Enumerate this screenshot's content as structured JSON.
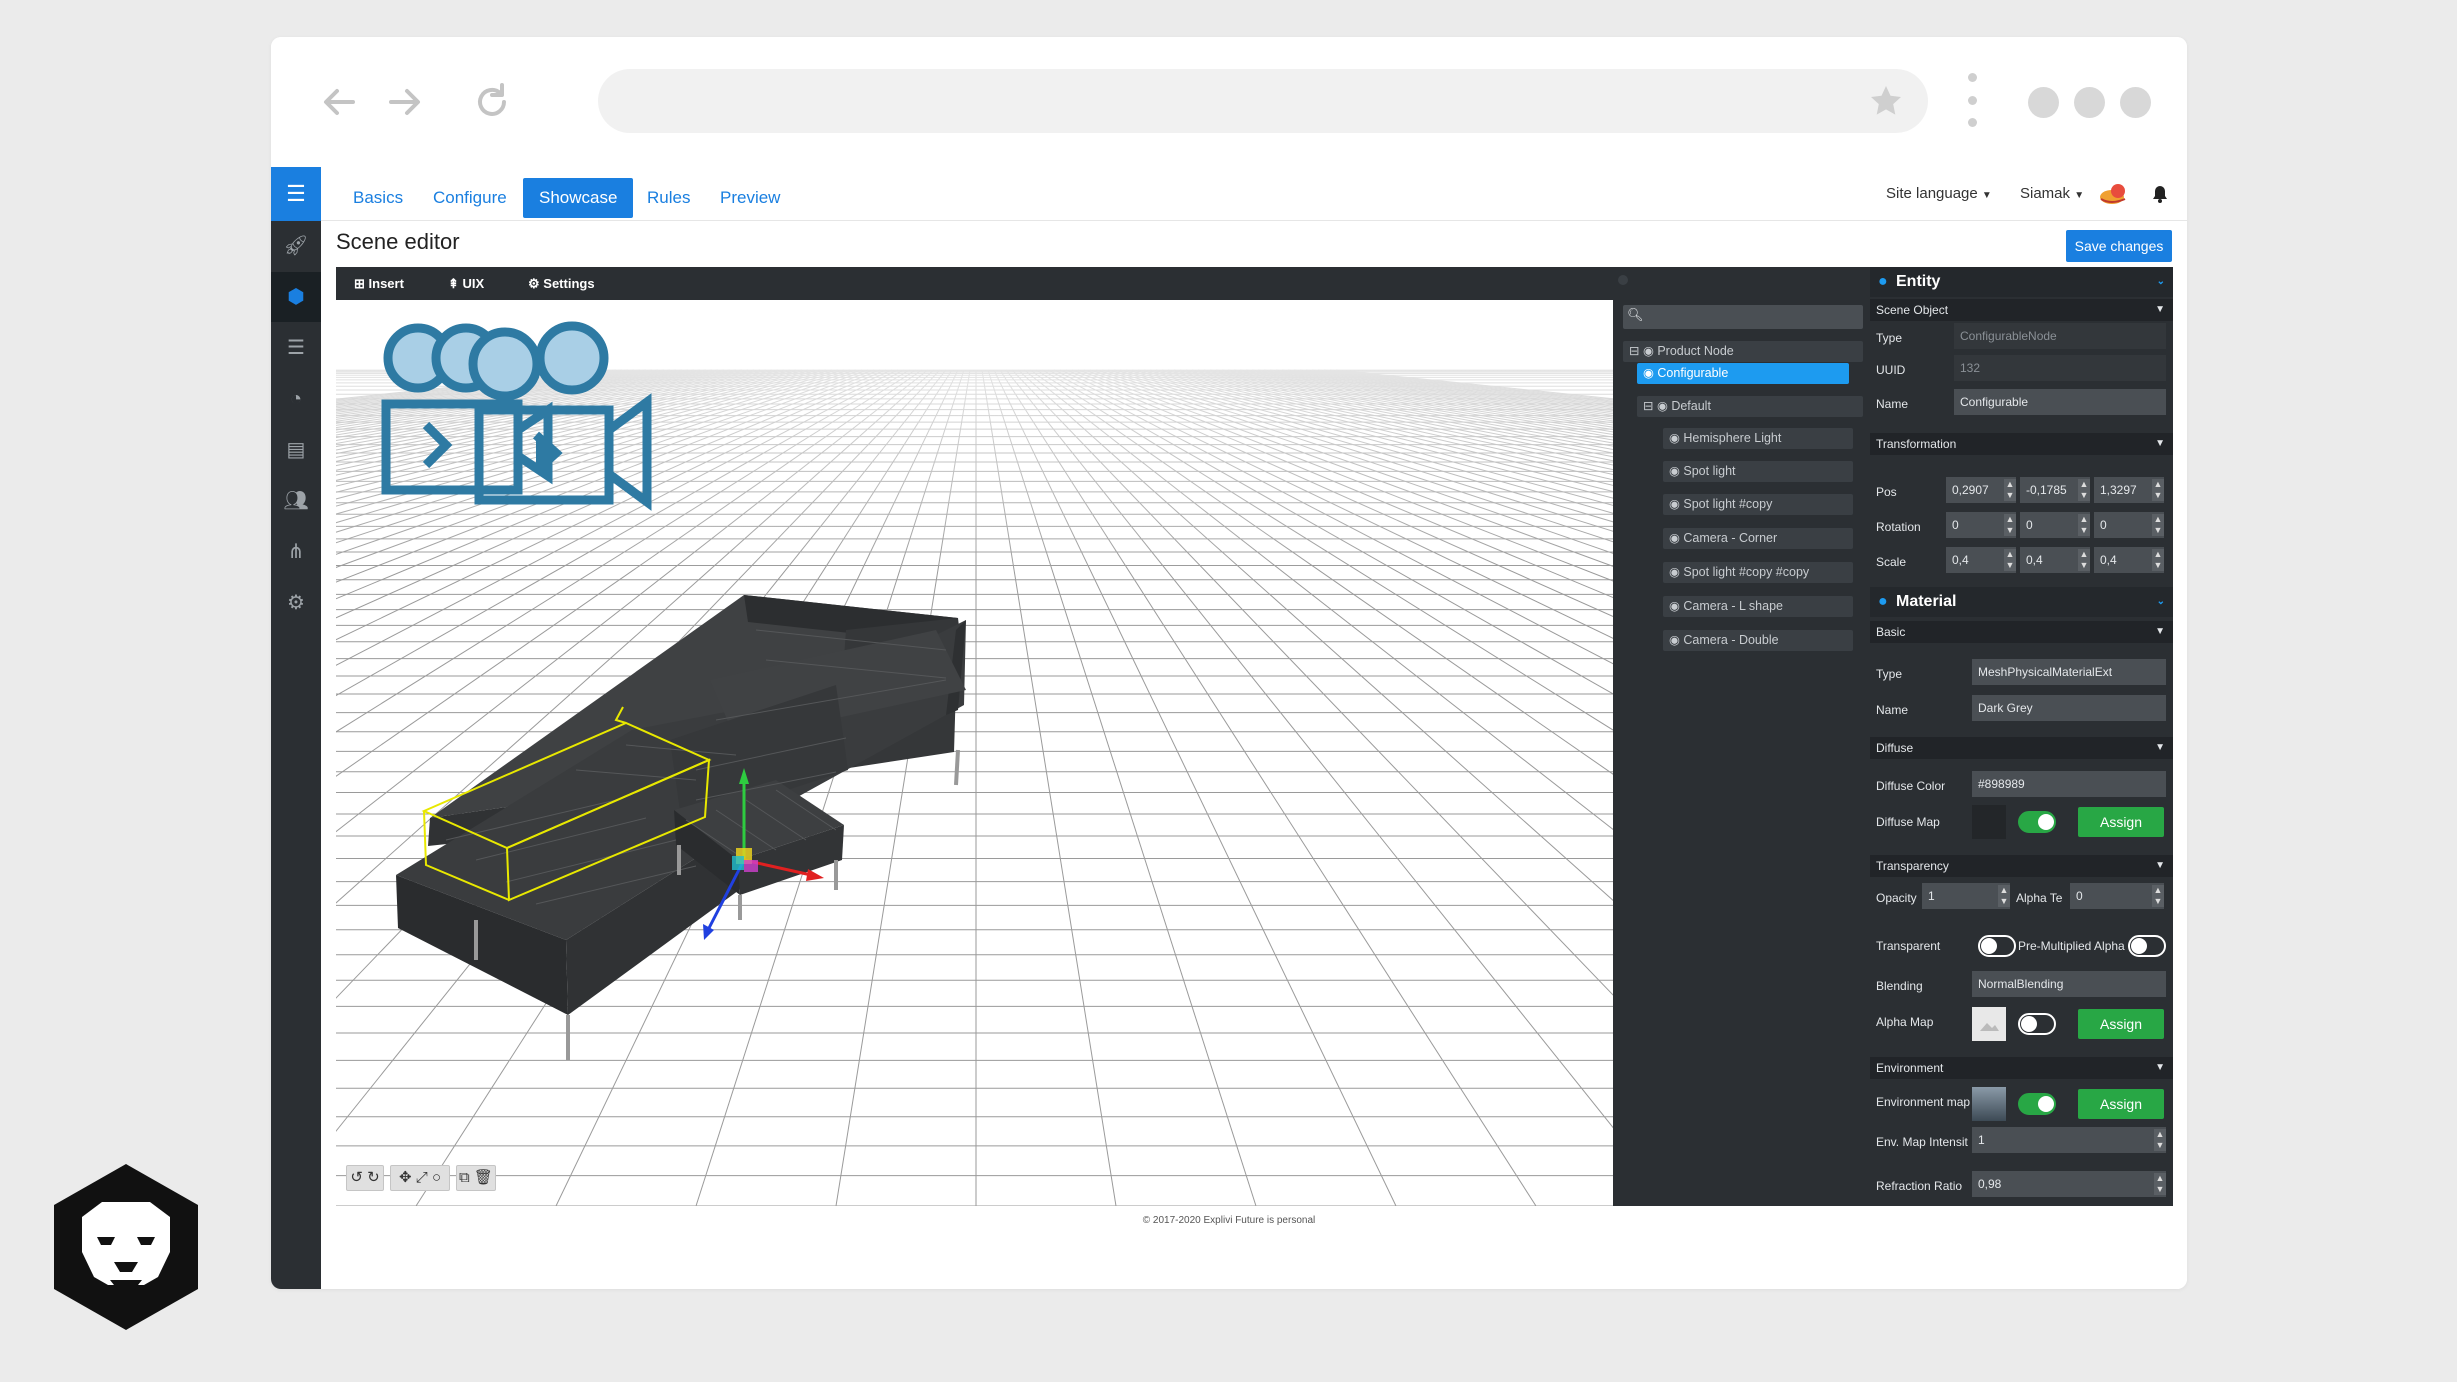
{
  "app": {
    "tabs": [
      "Basics",
      "Configure",
      "Showcase",
      "Rules",
      "Preview"
    ],
    "active_tab": "Showcase",
    "site_language": "Site language",
    "user": "Siamak",
    "page_title": "Scene editor",
    "save_label": "Save changes"
  },
  "viewport": {
    "toolbar": [
      "Insert",
      "UIX",
      "Settings"
    ]
  },
  "tree": {
    "nodes": [
      "Product Node",
      "Configurable",
      "Default",
      "Hemisphere Light",
      "Spot light",
      "Spot light #copy",
      "Camera - Corner",
      "Spot light #copy #copy",
      "Camera - L shape",
      "Camera - Double"
    ],
    "selected": "Configurable"
  },
  "props": {
    "entity_title": "Entity",
    "scene_object": "Scene Object",
    "type_label": "Type",
    "type_value": "ConfigurableNode",
    "uuid_label": "UUID",
    "uuid_value": "132",
    "name_label": "Name",
    "name_value": "Configurable",
    "transformation": "Transformation",
    "pos_label": "Pos",
    "pos": [
      "0,2907",
      "-0,1785",
      "1,3297"
    ],
    "rotation_label": "Rotation",
    "rotation": [
      "0",
      "0",
      "0"
    ],
    "scale_label": "Scale",
    "scale": [
      "0,4",
      "0,4",
      "0,4"
    ],
    "material_title": "Material",
    "basic": "Basic",
    "mat_type_value": "MeshPhysicalMaterialExt",
    "mat_name_value": "Dark Grey",
    "diffuse": "Diffuse",
    "diffuse_color_label": "Diffuse Color",
    "diffuse_color_value": "#898989",
    "diffuse_map_label": "Diffuse Map",
    "assign": "Assign",
    "transparency": "Transparency",
    "opacity_label": "Opacity",
    "opacity_value": "1",
    "alpha_test_label": "Alpha Te",
    "alpha_test_value": "0",
    "transparent_label": "Transparent",
    "premult_label": "Pre-Multiplied Alpha",
    "blending_label": "Blending",
    "blending_value": "NormalBlending",
    "alpha_map_label": "Alpha Map",
    "environment": "Environment",
    "env_map_label": "Environment map",
    "env_intensity_label": "Env. Map Intensit",
    "env_intensity_value": "1",
    "refraction_label": "Refraction Ratio",
    "refraction_value": "0,98"
  },
  "footer": "© 2017-2020 Explivi Future is personal",
  "colors": {
    "accent": "#1a7fe0",
    "panel": "#2b2f33",
    "green": "#28a745",
    "selected_node": "#1d9bf0",
    "bbox": "#e8e800"
  }
}
